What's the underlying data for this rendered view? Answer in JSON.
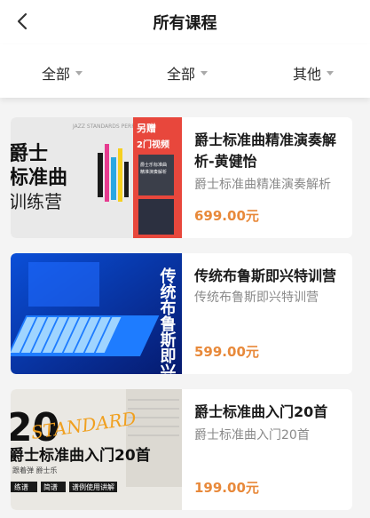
{
  "header": {
    "title": "所有课程"
  },
  "filters": [
    {
      "label": "全部"
    },
    {
      "label": "全部"
    },
    {
      "label": "其他"
    }
  ],
  "courses": [
    {
      "title": "爵士标准曲精准演奏解析-黄健怡",
      "subtitle": "爵士标准曲精准演奏解析",
      "price": "699.00元",
      "thumb": {
        "line1": "爵士",
        "line2": "标准曲",
        "line3": "训练营",
        "ribbon1": "另赠",
        "ribbon2": "2门视频",
        "small_caption": "JAZZ STANDARDS PERFORMANCE",
        "booklet1": "爵士乐标准曲",
        "booklet2": "精准演奏解析"
      }
    },
    {
      "title": "传统布鲁斯即兴特训营",
      "subtitle": "传统布鲁斯即兴特训营",
      "price": "599.00元",
      "thumb": {
        "vertical_text": "传统布鲁斯即兴"
      }
    },
    {
      "title": "爵士标准曲入门20首",
      "subtitle": "爵士标准曲入门20首",
      "price": "199.00元",
      "thumb": {
        "big_number": "20",
        "script": "STANDARD",
        "headline": "爵士标准曲入门20首",
        "caption": "跟着弹 爵士乐",
        "tags": [
          "练谱",
          "简谱",
          "谱例使用讲解"
        ]
      }
    }
  ]
}
